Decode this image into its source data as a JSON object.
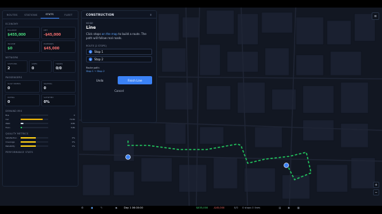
{
  "tabs": [
    {
      "label": "ROUTES"
    },
    {
      "label": "STATIONS"
    },
    {
      "label": "STATS"
    },
    {
      "label": "FLEET"
    }
  ],
  "economy": {
    "heading": "ECONOMY",
    "cards": [
      {
        "label": "BALANCE",
        "value": "$455,000"
      },
      {
        "label": "NET",
        "value": "-$45,000"
      },
      {
        "label": "INCOME",
        "value": "$0"
      },
      {
        "label": "EXPENSES",
        "value": "$45,000"
      }
    ]
  },
  "network": {
    "heading": "NETWORK",
    "cards": [
      {
        "label": "STATIONS",
        "value": "2"
      },
      {
        "label": "LINES",
        "value": "0"
      },
      {
        "label": "TRAINS",
        "value": "0/0"
      }
    ]
  },
  "passengers": {
    "heading": "PASSENGERS",
    "cards": [
      {
        "label": "DAILY RIDERS",
        "value": "0"
      },
      {
        "label": "WAITING",
        "value": "0"
      },
      {
        "label": "RATING",
        "value": "0"
      },
      {
        "label": "SATISFIED",
        "value": "0%"
      }
    ]
  },
  "demand": {
    "heading": "DEMAND MIX",
    "rows": [
      {
        "name": "Bus",
        "pct": 0,
        "value": "0",
        "color": "#22c55e"
      },
      {
        "name": "Car",
        "pct": 0.8,
        "value": "72.6K",
        "color": "#eab308"
      },
      {
        "name": "Walk",
        "pct": 0.1,
        "value": "9.8K",
        "color": "#cbd5e1"
      },
      {
        "name": "Train",
        "pct": 0.06,
        "value": "5.8K",
        "color": "#22c55e"
      }
    ]
  },
  "quality": {
    "heading": "QUALITY METRICS",
    "rows": [
      {
        "name": "Satisfaction",
        "pct": 0.55,
        "value": "0%",
        "color": "#facc15"
      },
      {
        "name": "Coverage",
        "pct": 0.55,
        "value": "0%",
        "color": "#facc15"
      },
      {
        "name": "Reliability",
        "pct": 0.55,
        "value": "0%",
        "color": "#facc15"
      }
    ]
  },
  "perf": {
    "heading": "PERFORMANCE STATS"
  },
  "construction": {
    "header": "CONSTRUCTION",
    "close": "×",
    "mode_label": "MODE",
    "mode": "Line",
    "instruction_pre": "Click stops ",
    "instruction_link": "on the map",
    "instruction_post": " to build a route. The path will follow real roads.",
    "route_label": "ROUTE (2 STOPS)",
    "stops": [
      {
        "num": "1",
        "name": "Stop 1"
      },
      {
        "num": "2",
        "name": "Stop 2"
      }
    ],
    "path_label": "Route path:",
    "path_seq": "Stop 1 → Stop 2",
    "undo": "Undo",
    "finish": "Finish Line",
    "cancel": "Cancel"
  },
  "bottombar": {
    "day": "Day 1 06:00:00",
    "money": "$455,000",
    "delta": "-$45,000",
    "trains": "0/0",
    "status": "0 stops 0 lines"
  },
  "colors": {
    "accent": "#3b82f6",
    "route": "#22c55e"
  }
}
